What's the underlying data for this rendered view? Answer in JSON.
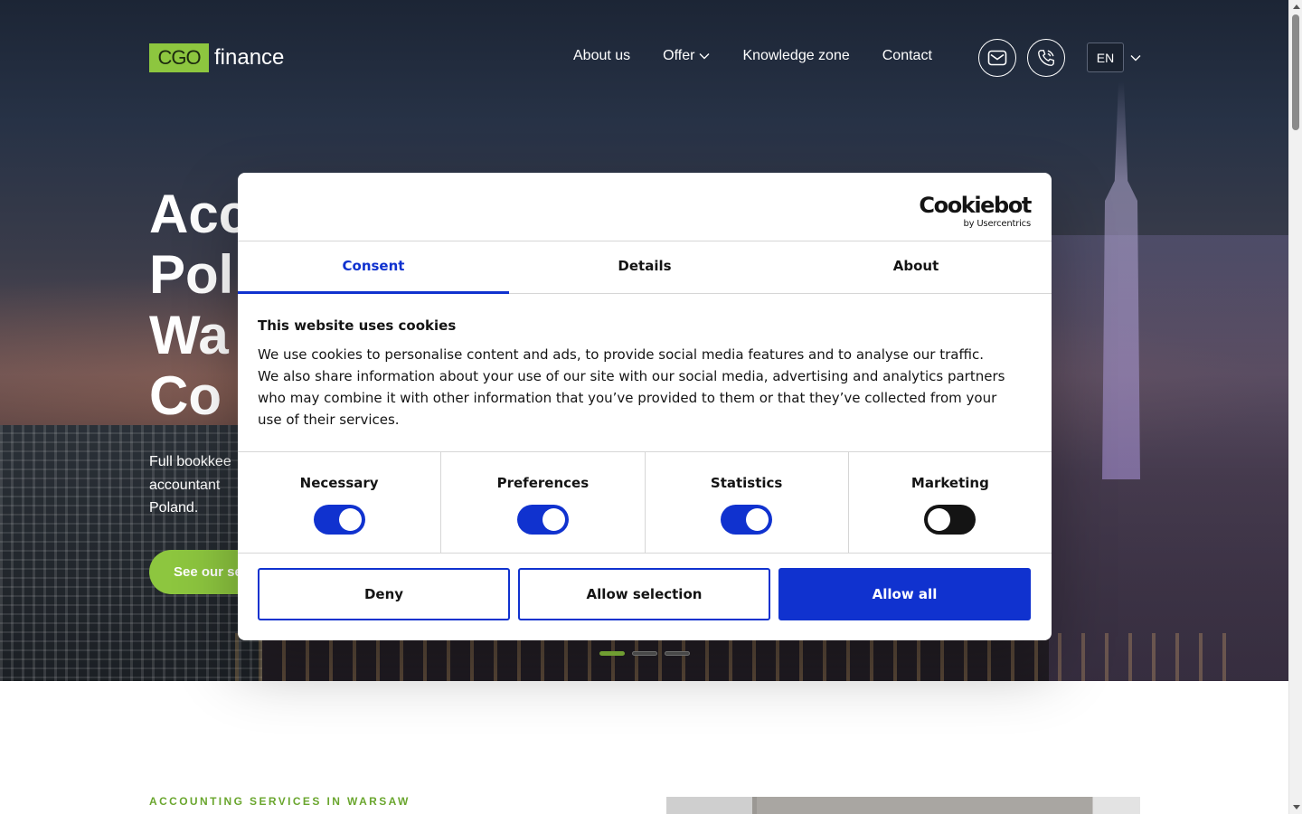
{
  "header": {
    "logo_box": "CGO",
    "logo_word": "finance",
    "nav": [
      "About us",
      "Offer",
      "Knowledge zone",
      "Contact"
    ],
    "language": "EN",
    "icons": [
      "mail-icon",
      "phone-icon",
      "chevron-down-icon"
    ]
  },
  "hero": {
    "title_lines": [
      "Acc",
      "Pol",
      "Wa",
      "Co"
    ],
    "subtitle_lines": [
      "Full bookkee",
      "accountant",
      "Poland."
    ],
    "cta": "See our se",
    "slides_total": 3,
    "slide_active": 1
  },
  "section": {
    "label": "ACCOUNTING SERVICES IN WARSAW"
  },
  "cookie_dialog": {
    "brand": "Cookiebot",
    "brand_sub": "by Usercentrics",
    "tabs": [
      "Consent",
      "Details",
      "About"
    ],
    "active_tab": "Consent",
    "title": "This website uses cookies",
    "text": "We use cookies to personalise content and ads, to provide social media features and to analyse our traffic. We also share information about your use of our site with our social media, advertising and analytics partners who may combine it with other information that you’ve provided to them or that they’ve collected from your use of their services.",
    "toggles": [
      {
        "label": "Necessary",
        "on": true
      },
      {
        "label": "Preferences",
        "on": true
      },
      {
        "label": "Statistics",
        "on": true
      },
      {
        "label": "Marketing",
        "on": false
      }
    ],
    "buttons": {
      "deny": "Deny",
      "allow_selection": "Allow selection",
      "allow_all": "Allow all"
    },
    "colors": {
      "accent": "#1032cf",
      "text": "#141414"
    }
  },
  "colors": {
    "brand_green": "#8dc63f"
  }
}
